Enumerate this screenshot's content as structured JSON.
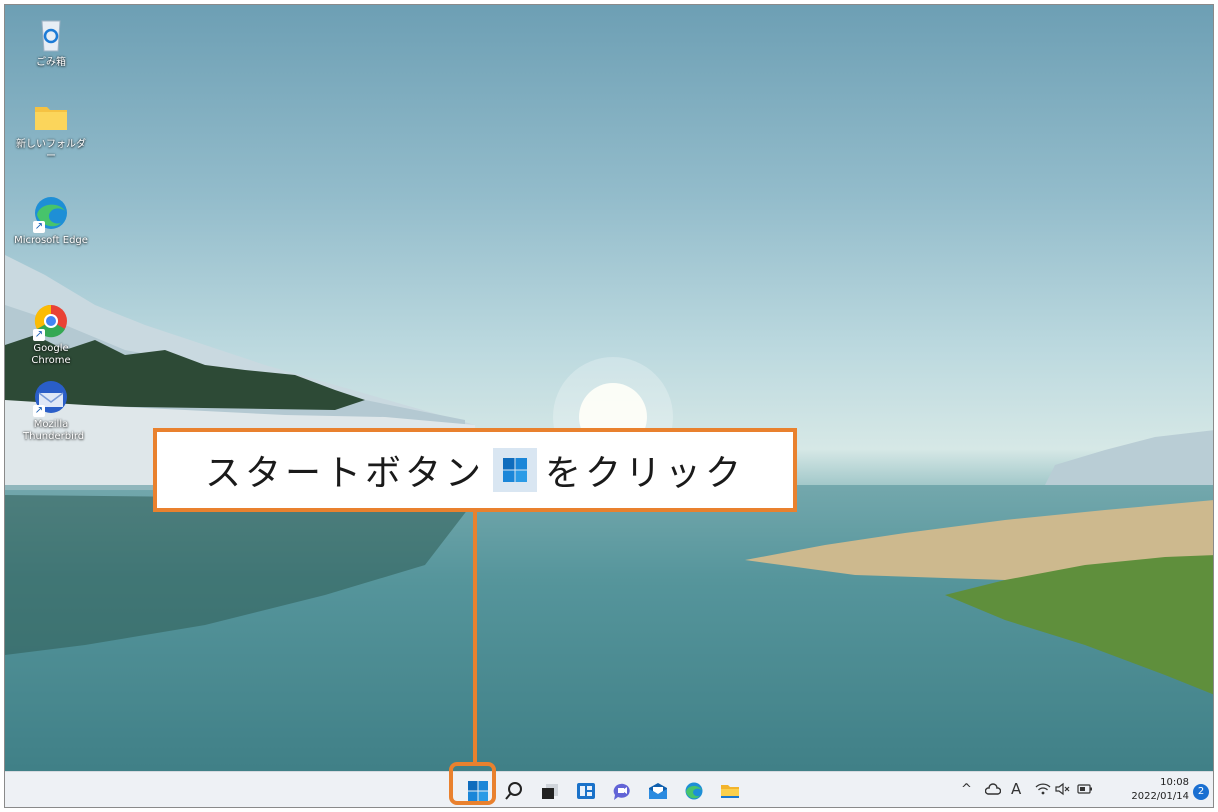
{
  "desktop": {
    "icons": [
      {
        "label": "ごみ箱",
        "icon": "recycle-bin-icon"
      },
      {
        "label": "新しいフォルダー",
        "icon": "folder-icon"
      },
      {
        "label": "Microsoft Edge",
        "icon": "edge-icon"
      },
      {
        "label": "Google Chrome",
        "icon": "chrome-icon"
      },
      {
        "label": "Mozilla Thunderbird",
        "icon": "thunderbird-icon"
      }
    ]
  },
  "callout": {
    "before": "スタートボタン",
    "after": "をクリック",
    "accent": "#e9812e"
  },
  "taskbar": {
    "apps": [
      "start-icon",
      "search-icon",
      "task-view-icon",
      "widgets-icon",
      "teams-chat-icon",
      "mail-icon",
      "edge-icon",
      "file-explorer-icon"
    ],
    "tray": {
      "chevron": "^",
      "ime": "A",
      "time": "10:08",
      "date": "2022/01/14",
      "notifications": "2"
    }
  }
}
